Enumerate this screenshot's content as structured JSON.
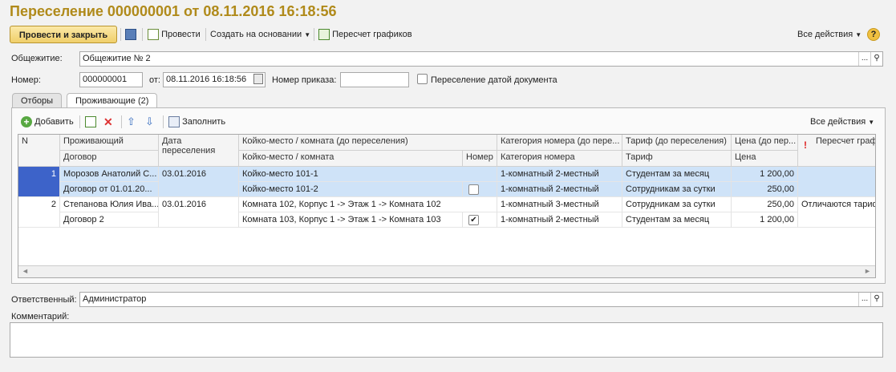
{
  "header": {
    "title": "Переселение 000000001 от 08.11.2016 16:18:56"
  },
  "toolbar": {
    "post_close": "Провести и закрыть",
    "post": "Провести",
    "create_based": "Создать на основании",
    "recalc": "Пересчет графиков",
    "all_actions": "Все действия",
    "help": "?"
  },
  "form": {
    "dorm_label": "Общежитие:",
    "dorm_value": "Общежитие № 2",
    "number_label": "Номер:",
    "number_value": "000000001",
    "date_label": "от:",
    "date_value": "08.11.2016 16:18:56",
    "order_label": "Номер приказа:",
    "order_value": "",
    "move_by_date_label": "Переселение датой документа",
    "responsible_label": "Ответственный:",
    "responsible_value": "Администратор",
    "comment_label": "Комментарий:"
  },
  "tabs": {
    "filters": "Отборы",
    "residents": "Проживающие (2)"
  },
  "grid_toolbar": {
    "add": "Добавить",
    "fill": "Заполнить",
    "all_actions": "Все действия"
  },
  "columns": {
    "n": "N",
    "resident": "Проживающий",
    "contract": "Договор",
    "move_date": "Дата",
    "move_date2": "переселения",
    "bed_before": "Койко-место / комната (до переселения)",
    "bed": "Койко-место / комната",
    "room_flag": "Номер",
    "cat_before": "Категория номера (до пере...",
    "cat": "Категория номера",
    "tariff_before": "Тариф (до переселения)",
    "tariff": "Тариф",
    "price_before": "Цена (до пер...",
    "price": "Цена",
    "recalc": "Пересчет граф"
  },
  "rows": [
    {
      "n": "1",
      "resident": "Морозов Анатолий С...",
      "contract": "Договор  от 01.01.20...",
      "date": "03.01.2016",
      "bed_before": "Койко-место 101-1",
      "bed": "Койко-место 101-2",
      "room_flag": "",
      "cat_before": "1-комнатный 2-местный",
      "cat": "1-комнатный 2-местный",
      "tariff_before": "Студентам за месяц",
      "tariff": "Сотрудникам за сутки",
      "price_before": "1 200,00",
      "price": "250,00",
      "recalc": ""
    },
    {
      "n": "2",
      "resident": "Степанова Юлия Ива...",
      "contract": "Договор 2",
      "date": "03.01.2016",
      "bed_before": "Комната 102, Корпус 1 -> Этаж 1 -> Комната 102",
      "bed": "Комната 103, Корпус 1 -> Этаж 1 -> Комната 103",
      "room_flag": "✔",
      "cat_before": "1-комнатный 3-местный",
      "cat": "1-комнатный 2-местный",
      "tariff_before": "Сотрудникам за сутки",
      "tariff": "Студентам за месяц",
      "price_before": "250,00",
      "price": "1 200,00",
      "recalc": "Отличаются тариф"
    }
  ]
}
